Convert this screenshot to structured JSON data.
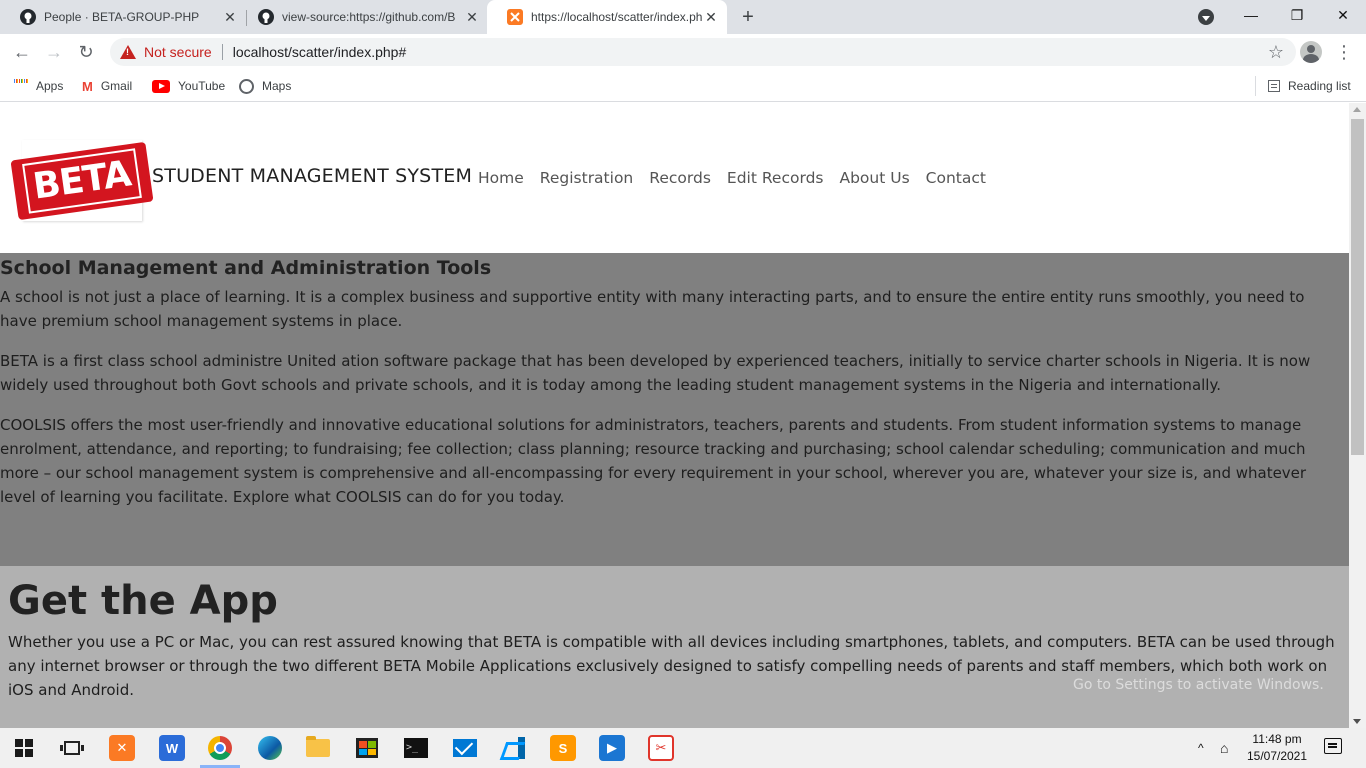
{
  "browser": {
    "tabs": [
      {
        "title": "People · BETA-GROUP-PHP",
        "icon": "github-icon"
      },
      {
        "title": "view-source:https://github.com/B",
        "icon": "github-icon"
      },
      {
        "title": "https://localhost/scatter/index.ph",
        "icon": "xampp-icon",
        "active": true
      }
    ],
    "security_label": "Not secure",
    "url": "localhost/scatter/index.php#",
    "bookmarks": [
      {
        "label": "Apps",
        "icon": "apps-grid-icon"
      },
      {
        "label": "Gmail",
        "icon": "gmail-icon"
      },
      {
        "label": "YouTube",
        "icon": "youtube-icon"
      },
      {
        "label": "Maps",
        "icon": "maps-icon"
      }
    ],
    "reading_list_label": "Reading list"
  },
  "site": {
    "logo_text": "BETA",
    "brand": "STUDENT MANAGEMENT SYSTEM",
    "nav": [
      "Home",
      "Registration",
      "Records",
      "Edit Records",
      "About Us",
      "Contact"
    ]
  },
  "section_tools": {
    "heading": "School Management and Administration Tools",
    "paragraphs": [
      "A school is not just a place of learning. It is a complex business and supportive entity with many interacting parts, and to ensure the entire entity runs smoothly, you need to have premium school management systems in place.",
      "BETA is a first class school administre United ation software package that has been developed by experienced teachers, initially to service charter schools in Nigeria. It is now widely used throughout both Govt schools and private schools, and it is today among the leading student management systems in the Nigeria and internationally.",
      "COOLSIS offers the most user-friendly and innovative educational solutions for administrators, teachers, parents and students. From student information systems to manage enrolment, attendance, and reporting; to fundraising; fee collection; class planning; resource tracking and purchasing; school calendar scheduling; communication and much more – our school management system is comprehensive and all-encompassing for every requirement in your school, wherever you are, whatever your size is, and whatever level of learning you facilitate. Explore what COOLSIS can do for you today."
    ]
  },
  "section_app": {
    "heading": "Get the App",
    "paragraph": "Whether you use a PC or Mac, you can rest assured knowing that BETA is compatible with all devices including smartphones, tablets, and computers. BETA can be used through any internet browser or through the two different BETA Mobile Applications exclusively designed to satisfy compelling needs of parents and staff members, which both work on iOS and Android."
  },
  "watermark": "Go to Settings to activate Windows.",
  "taskbar": {
    "time": "11:48 pm",
    "date": "15/07/2021"
  },
  "colors": {
    "dark_section": "#808080",
    "light_section": "#b1b1b1",
    "logo_red": "#d3151f",
    "not_secure": "#c5221f"
  }
}
